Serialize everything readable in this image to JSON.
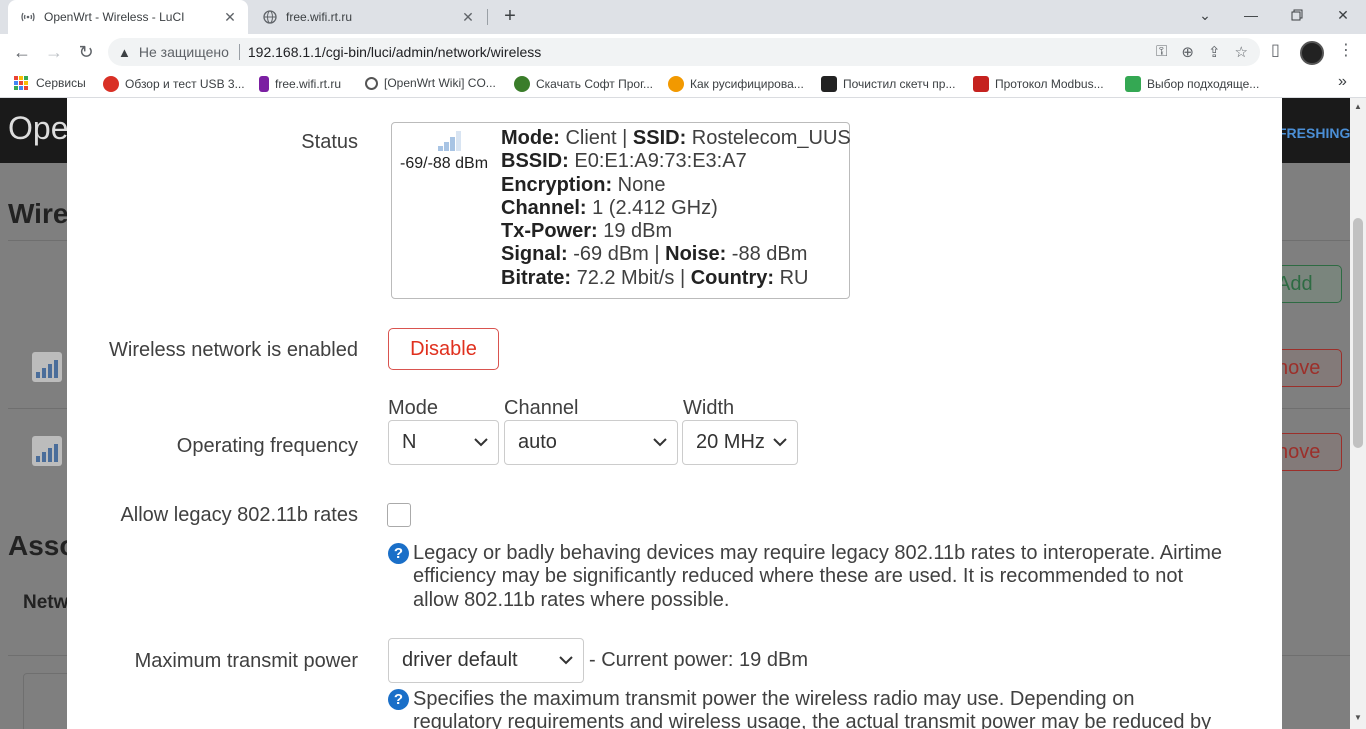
{
  "browser": {
    "tabs": [
      {
        "title": "OpenWrt - Wireless - LuCI",
        "icon": "wifi-icon"
      },
      {
        "title": "free.wifi.rt.ru",
        "icon": "globe-icon"
      }
    ],
    "new_tab": "+",
    "security_label": "Не защищено",
    "url": "192.168.1.1/cgi-bin/luci/admin/network/wireless",
    "bookmarks": [
      {
        "label": "Сервисы",
        "color": "#e94235"
      },
      {
        "label": "Обзор и тест USB 3...",
        "color": "#d93025"
      },
      {
        "label": "free.wifi.rt.ru",
        "color": "#7b1fa2"
      },
      {
        "label": "[OpenWrt Wiki] CO...",
        "color": "#555555"
      },
      {
        "label": "Скачать Софт Прог...",
        "color": "#3a7d2a"
      },
      {
        "label": "Как русифицирова...",
        "color": "#f29900"
      },
      {
        "label": "Почистил скетч пр...",
        "color": "#222222"
      },
      {
        "label": "Протокол Modbus...",
        "color": "#c5221f"
      },
      {
        "label": "Выбор подходяще...",
        "color": "#34a853"
      }
    ],
    "more_bookmarks": "»"
  },
  "background": {
    "logo": "Ope",
    "refreshing": "FRESHING",
    "heading_wireless": "Wire",
    "heading_assoc": "Asso",
    "netw": "Netw",
    "add_label": "Add",
    "remove_label": "nove"
  },
  "modal": {
    "status": {
      "label": "Status",
      "signal_text": "-69/-88 dBm",
      "lines": {
        "mode_key": "Mode:",
        "mode_val": " Client | ",
        "ssid_key": "SSID:",
        "ssid_val": " Rostelecom_UUS",
        "bssid_key": "BSSID:",
        "bssid_val": " E0:E1:A9:73:E3:A7",
        "enc_key": "Encryption:",
        "enc_val": " None",
        "chan_key": "Channel:",
        "chan_val": " 1 (2.412 GHz)",
        "tx_key": "Tx-Power:",
        "tx_val": " 19 dBm",
        "sig_key": "Signal:",
        "sig_val": " -69 dBm | ",
        "noise_key": "Noise:",
        "noise_val": " -88 dBm",
        "bitrate_key": "Bitrate:",
        "bitrate_val": " 72.2 Mbit/s | ",
        "country_key": "Country:",
        "country_val": " RU"
      }
    },
    "enabled": {
      "label": "Wireless network is enabled",
      "button": "Disable"
    },
    "frequency": {
      "label": "Operating frequency",
      "mode_label": "Mode",
      "mode_value": "N",
      "channel_label": "Channel",
      "channel_value": "auto",
      "width_label": "Width",
      "width_value": "20 MHz"
    },
    "legacy": {
      "label": "Allow legacy 802.11b rates",
      "checked": false,
      "help": "Legacy or badly behaving devices may require legacy 802.11b rates to interoperate. Airtime efficiency may be significantly reduced where these are used. It is recommended to not allow 802.11b rates where possible."
    },
    "txpower": {
      "label": "Maximum transmit power",
      "value": "driver default",
      "current": "- Current power: 19 dBm",
      "help": "Specifies the maximum transmit power the wireless radio may use. Depending on regulatory requirements and wireless usage, the actual transmit power may be reduced by the driver."
    }
  },
  "colors": {
    "accent": "#1a6fc8",
    "danger": "#e0301e",
    "success": "#2e8b57"
  }
}
